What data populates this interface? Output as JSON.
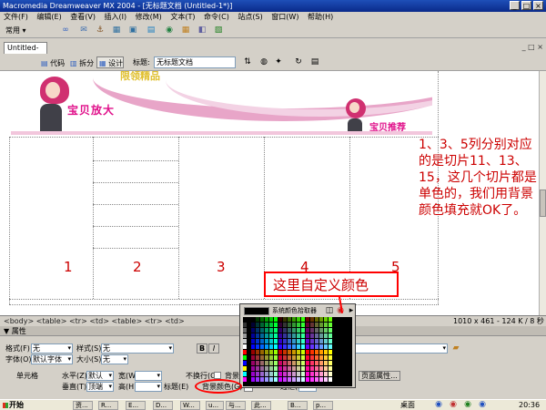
{
  "window": {
    "title": "Macromedia Dreamweaver MX 2004 - [无标题文档 (Untitled-1*)]",
    "controls": [
      "_",
      "□",
      "×"
    ]
  },
  "menu": [
    "文件(F)",
    "编辑(E)",
    "查看(V)",
    "插入(I)",
    "修改(M)",
    "文本(T)",
    "命令(C)",
    "站点(S)",
    "窗口(W)",
    "帮助(H)"
  ],
  "insert_toolbar": {
    "category": "常用"
  },
  "document": {
    "tab": "Untitled-1*",
    "view_code": "代码",
    "view_split": "拆分",
    "view_design": "设计",
    "title_label": "标题:",
    "title_value": "无标题文档"
  },
  "banner": {
    "top_text": "限领精品",
    "baby_label": "宝贝放大",
    "recommend_label": "宝贝推荐"
  },
  "columns": [
    "1",
    "2",
    "3",
    "4",
    "5"
  ],
  "annotation_main": "1、3、5列分别对应的是切片11、13、15，这几个切片都是单色的，我们用背景颜色填充就OK了。",
  "annotation_custom": "这里自定义颜色",
  "statusbar": {
    "tag_selector": "<body> <table> <tr> <td> <table> <tr> <td>",
    "size": "1010 x 461 - 124 K / 8 秒"
  },
  "properties": {
    "title": "▼ 属性",
    "format_label": "格式(F)",
    "format_value": "无",
    "style_label": "样式(S)",
    "style_value": "无",
    "font_label": "字体(O)",
    "font_value": "默认字体",
    "size_label": "大小(S)",
    "size_value": "无",
    "cell_label": "单元格",
    "horz_label": "水平(Z)",
    "horz_value": "默认",
    "width_label": "宽(W)",
    "nowrap_label": "不换行(O)",
    "bg_label": "背景(B)",
    "vert_label": "垂直(T)",
    "vert_value": "顶端",
    "height_label": "高(H)",
    "header_label": "标题(E)",
    "bgcolor_label": "背景颜色(G)",
    "border_label": "边框(R)",
    "page_props_button": "页面属性..."
  },
  "color_picker": {
    "label": "系统颜色拾取器",
    "selected_color": "#000000"
  },
  "taskbar": {
    "start": "开始",
    "tasks": [
      "资...",
      "R...",
      "E...",
      "D...",
      "W...",
      "u...",
      "与...",
      "此...",
      "B...",
      "p..."
    ],
    "tray_label": "桌面",
    "clock": "20:36"
  },
  "colors": {
    "annotation": "#cc0000",
    "banner_pink": "#e0108a",
    "titlebar": "#0a2a8a"
  }
}
